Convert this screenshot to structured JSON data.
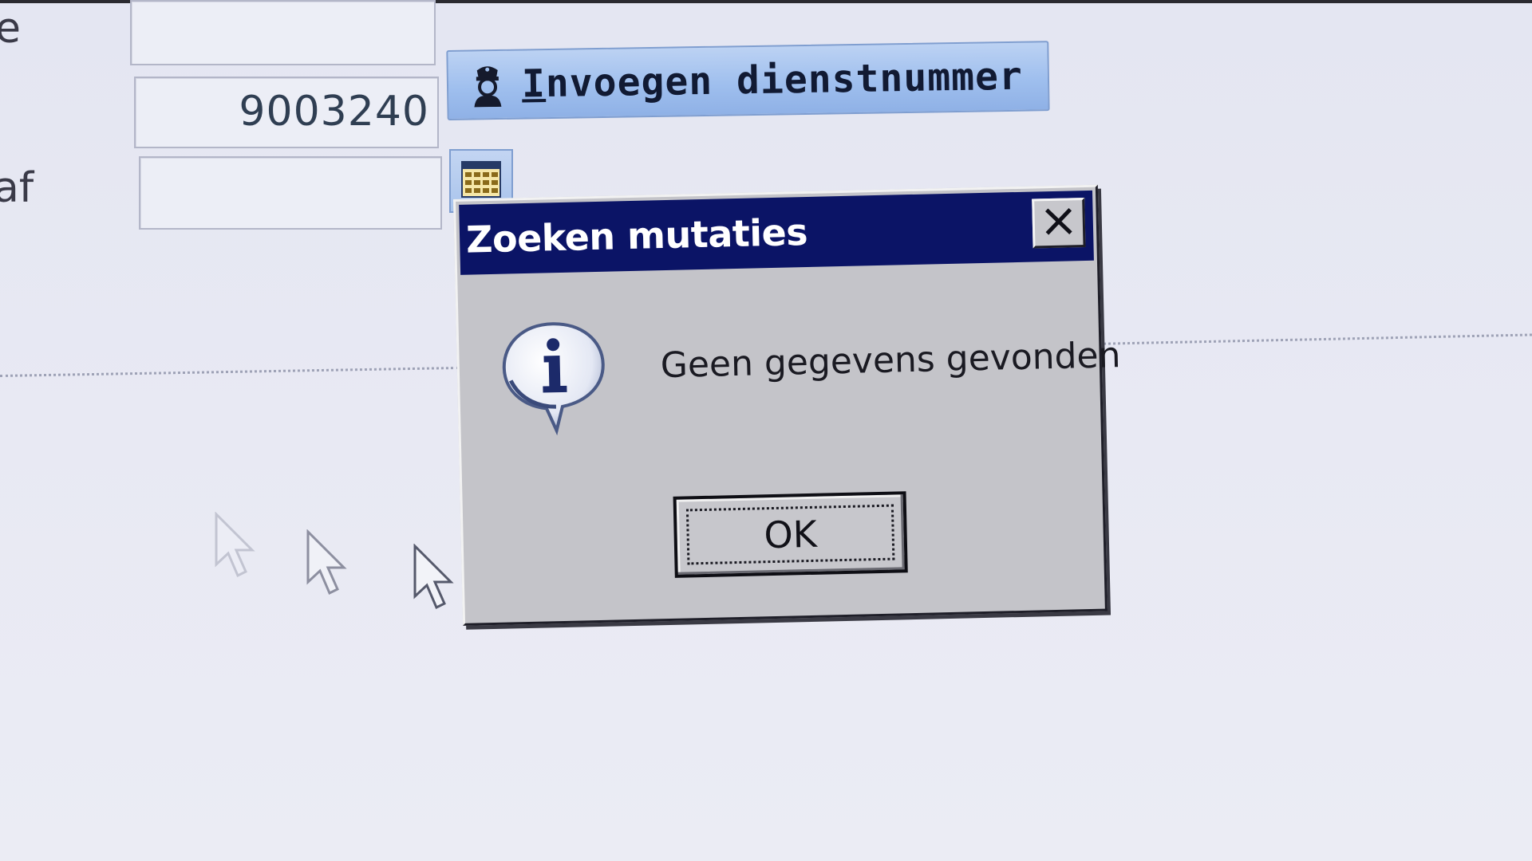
{
  "form": {
    "label_top_fragment": "e",
    "label_bottom_fragment": "af",
    "service_number_value": "9003240",
    "insert_button_label": "Invoegen dienstnummer"
  },
  "dialog": {
    "title": "Zoeken mutaties",
    "message": "Geen gegevens gevonden",
    "ok_label": "OK",
    "icon": "info-speech-bubble-icon",
    "titlebar_color": "#0b1466"
  },
  "colors": {
    "button_accent": "#9fbfee",
    "dialog_face": "#c4c4c9",
    "background": "#e6e8f3"
  }
}
